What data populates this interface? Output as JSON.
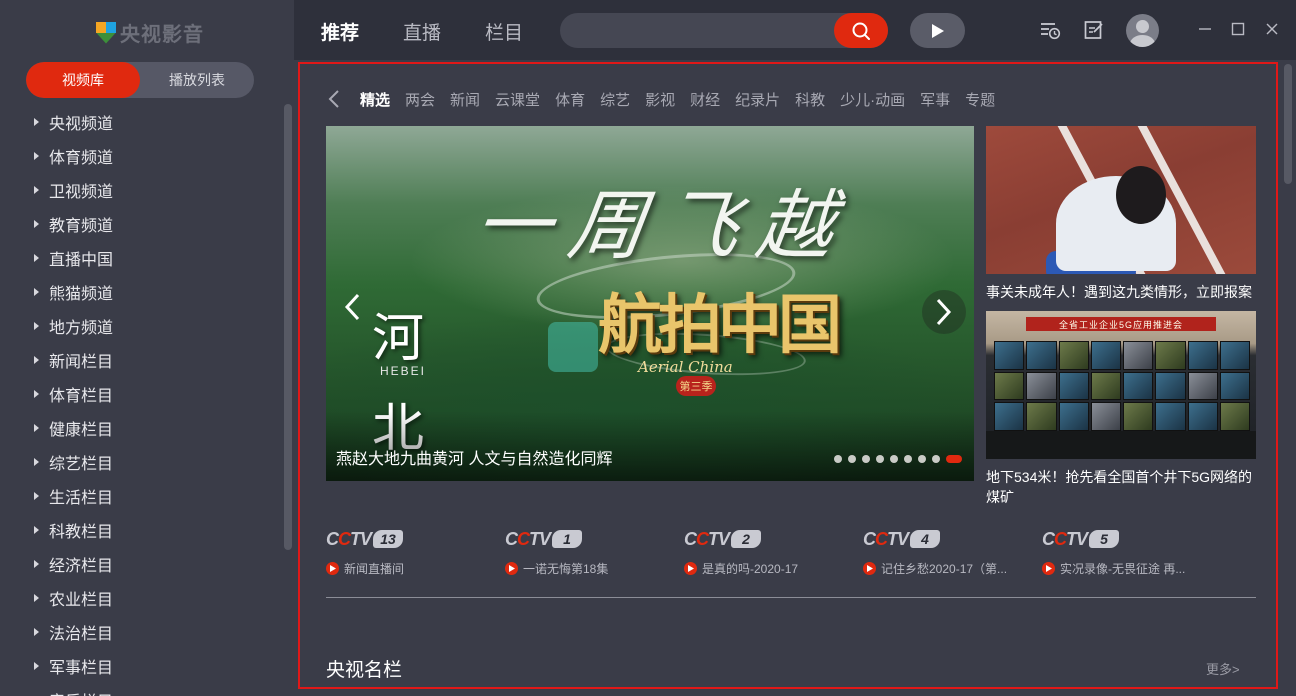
{
  "app": {
    "logo_text": "央视影音"
  },
  "sidebar": {
    "segments": [
      {
        "label": "视频库",
        "active": true
      },
      {
        "label": "播放列表",
        "active": false
      }
    ],
    "items": [
      {
        "label": "央视频道"
      },
      {
        "label": "体育频道"
      },
      {
        "label": "卫视频道"
      },
      {
        "label": "教育频道"
      },
      {
        "label": "直播中国"
      },
      {
        "label": "熊猫频道"
      },
      {
        "label": "地方频道"
      },
      {
        "label": "新闻栏目"
      },
      {
        "label": "体育栏目"
      },
      {
        "label": "健康栏目"
      },
      {
        "label": "综艺栏目"
      },
      {
        "label": "生活栏目"
      },
      {
        "label": "科教栏目"
      },
      {
        "label": "经济栏目"
      },
      {
        "label": "农业栏目"
      },
      {
        "label": "法治栏目"
      },
      {
        "label": "军事栏目"
      },
      {
        "label": "音乐栏目"
      }
    ]
  },
  "topbar": {
    "tabs": [
      {
        "label": "推荐",
        "active": true
      },
      {
        "label": "直播",
        "active": false
      },
      {
        "label": "栏目",
        "active": false
      }
    ],
    "search": {
      "value": "",
      "placeholder": ""
    },
    "icons": [
      "search-icon",
      "play-icon",
      "history-icon",
      "edit-icon",
      "avatar",
      "minimize-icon",
      "maximize-icon",
      "close-icon"
    ]
  },
  "categories": [
    "精选",
    "两会",
    "新闻",
    "云课堂",
    "体育",
    "综艺",
    "影视",
    "财经",
    "纪录片",
    "科教",
    "少儿·动画",
    "军事",
    "专题"
  ],
  "hero": {
    "title_art": "一周飞越",
    "side_art": "河北",
    "hebei": "HEBEI",
    "logo_art": "航拍中国",
    "aerial": "Aerial China",
    "season": "第三季",
    "caption": "燕赵大地九曲黄河 人文与自然造化同辉",
    "dots_total": 9,
    "dot_active": 8
  },
  "side_cards": [
    {
      "title": "事关未成年人！遇到这九类情形，立即报案"
    },
    {
      "title": "地下534米！抢先看全国首个井下5G网络的煤矿",
      "banner": "全省工业企业5G应用推进会"
    }
  ],
  "channels": [
    {
      "num": "13",
      "program": "新闻直播间"
    },
    {
      "num": "1",
      "program": "一诺无悔第18集"
    },
    {
      "num": "2",
      "program": "是真的吗-2020-17"
    },
    {
      "num": "4",
      "program": "记住乡愁2020-17（第..."
    },
    {
      "num": "5",
      "program": "实况录像-无畏征途 再..."
    }
  ],
  "section": {
    "title": "央视名栏",
    "more": "更多>"
  },
  "colors": {
    "accent": "#e0290f",
    "frame": "#e01818",
    "bg": "#3a3c48",
    "topbar": "#2e303b"
  }
}
